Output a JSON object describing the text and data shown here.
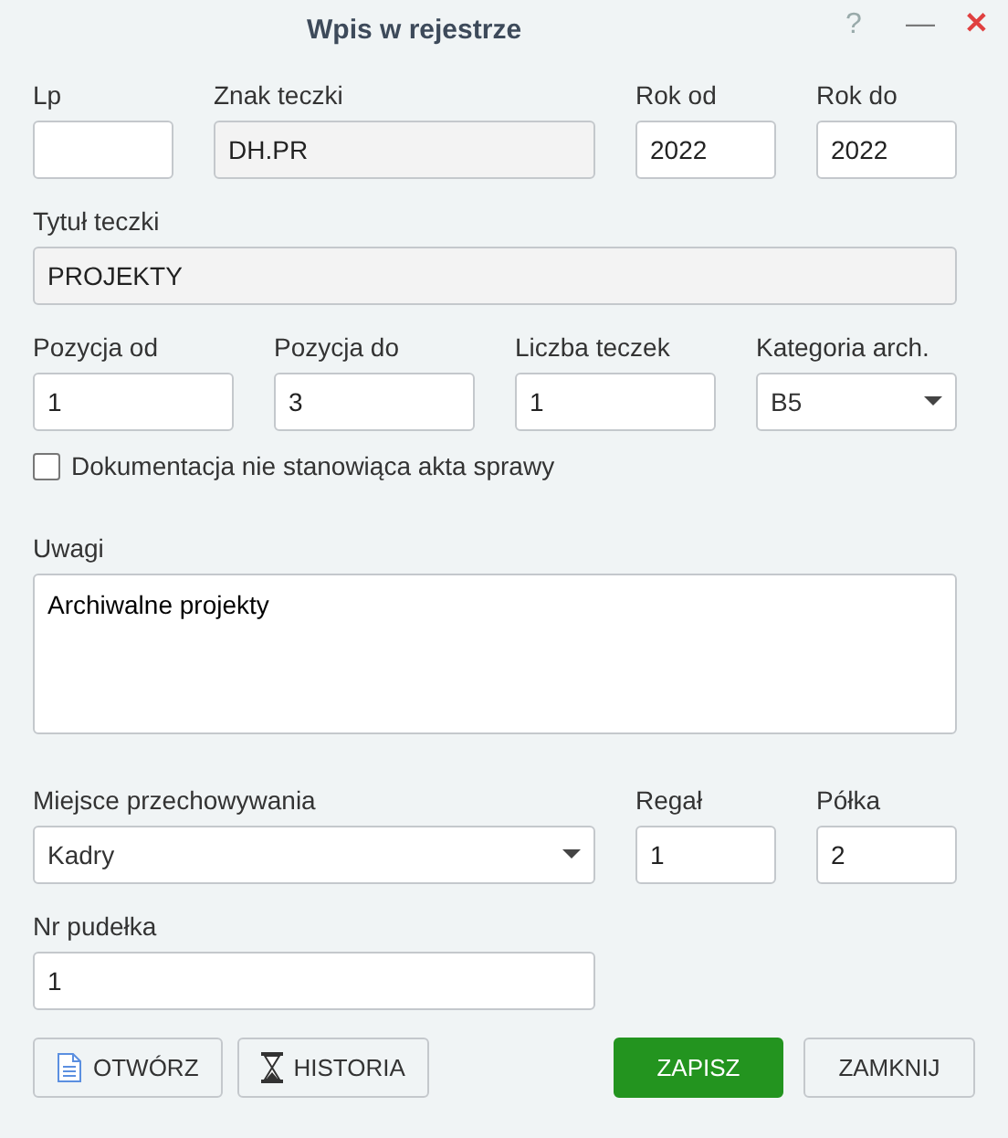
{
  "window": {
    "title": "Wpis w rejestrze",
    "help": "?",
    "minimize": "—",
    "close": "✕"
  },
  "rows": [
    {
      "fields": [
        {
          "kind": "text",
          "label": "Lp",
          "readonly": false
        },
        {
          "kind": "text",
          "label": "Znak teczki",
          "value": "DH.PR",
          "readonly": true
        },
        {
          "kind": "text",
          "label": "Rok od",
          "value": "2022",
          "readonly": false
        },
        {
          "kind": "text",
          "label": "Rok do",
          "value": "2022",
          "readonly": false
        }
      ]
    },
    {
      "fields": [
        {
          "kind": "text",
          "label": "Tytuł teczki",
          "value": "PROJEKTY",
          "readonly": true
        }
      ]
    },
    {
      "fields": [
        {
          "kind": "text",
          "label": "Pozycja od",
          "value": "1",
          "readonly": false
        },
        {
          "kind": "text",
          "label": "Pozycja do",
          "value": "3",
          "readonly": false
        },
        {
          "kind": "text",
          "label": "Liczba teczek",
          "value": "1",
          "readonly": false
        },
        {
          "kind": "select",
          "label": "Kategoria arch.",
          "value": "B5",
          "readonly": false
        }
      ]
    },
    {
      "fields": [
        {
          "kind": "checkbox",
          "label": "Dokumentacja nie stanowiąca akta sprawy",
          "checked": false
        }
      ]
    },
    {
      "fields": [
        {
          "kind": "textarea",
          "label": "Uwagi",
          "value": "Archiwalne projekty",
          "readonly": false
        }
      ]
    },
    {
      "fields": [
        {
          "kind": "select",
          "label": "Miejsce przechowywania",
          "value": "Kadry",
          "readonly": false
        },
        {
          "kind": "text",
          "label": "Regał",
          "value": "1",
          "readonly": false
        },
        {
          "kind": "text",
          "label": "Półka",
          "value": "2",
          "readonly": false
        }
      ]
    },
    {
      "fields": [
        {
          "kind": "text",
          "label": "Nr pudełka",
          "value": "1",
          "readonly": false
        }
      ]
    }
  ],
  "buttons": [
    {
      "label": "OTWÓRZ",
      "kind": "document"
    },
    {
      "label": "HISTORIA",
      "kind": "hourglass"
    },
    {
      "label": "ZAPISZ",
      "kind": "primary"
    },
    {
      "label": "ZAMKNIJ",
      "kind": "plain"
    }
  ]
}
